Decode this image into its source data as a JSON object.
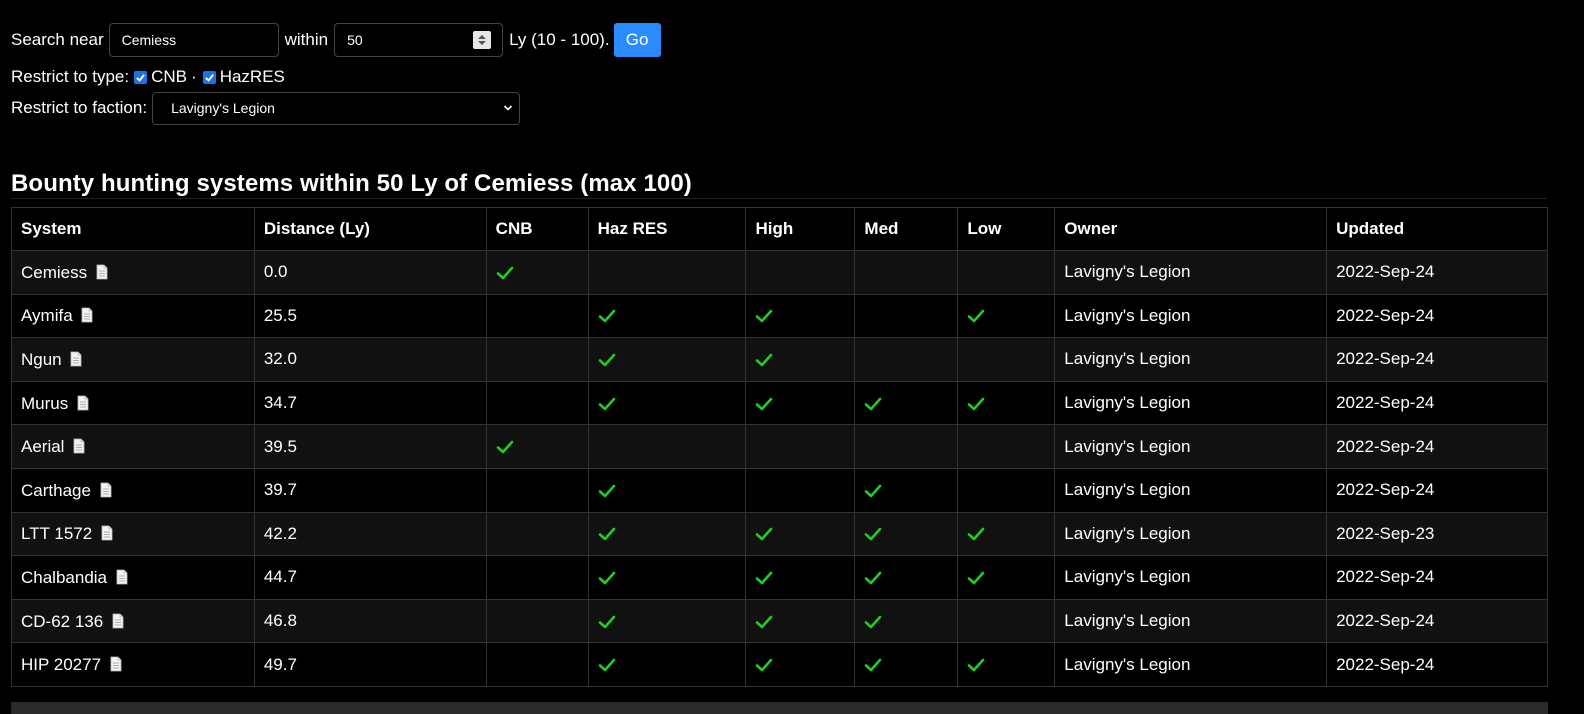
{
  "search": {
    "near_label": "Search near",
    "near_value": "Cemiess",
    "within_label": "within",
    "within_value": "50",
    "range_label": "Ly (10 - 100).",
    "go_label": "Go"
  },
  "type_filter": {
    "label": "Restrict to type:",
    "options": [
      {
        "label": "CNB",
        "checked": true
      },
      {
        "label": "HazRES",
        "checked": true
      }
    ],
    "separator": "·"
  },
  "faction_filter": {
    "label": "Restrict to faction:",
    "selected": "Lavigny's Legion"
  },
  "results": {
    "title_prefix": "Bounty hunting systems within ",
    "title_distance": "50 Ly",
    "title_mid": " of ",
    "title_system": "Cemiess",
    "title_suffix": " (max 100)",
    "columns": [
      "System",
      "Distance (Ly)",
      "CNB",
      "Haz RES",
      "High",
      "Med",
      "Low",
      "Owner",
      "Updated"
    ],
    "rows": [
      {
        "system": "Cemiess",
        "distance": "0.0",
        "cnb": true,
        "haz": false,
        "high": false,
        "med": false,
        "low": false,
        "owner": "Lavigny's Legion",
        "updated": "2022-Sep-24"
      },
      {
        "system": "Aymifa",
        "distance": "25.5",
        "cnb": false,
        "haz": true,
        "high": true,
        "med": false,
        "low": true,
        "owner": "Lavigny's Legion",
        "updated": "2022-Sep-24"
      },
      {
        "system": "Ngun",
        "distance": "32.0",
        "cnb": false,
        "haz": true,
        "high": true,
        "med": false,
        "low": false,
        "owner": "Lavigny's Legion",
        "updated": "2022-Sep-24"
      },
      {
        "system": "Murus",
        "distance": "34.7",
        "cnb": false,
        "haz": true,
        "high": true,
        "med": true,
        "low": true,
        "owner": "Lavigny's Legion",
        "updated": "2022-Sep-24"
      },
      {
        "system": "Aerial",
        "distance": "39.5",
        "cnb": true,
        "haz": false,
        "high": false,
        "med": false,
        "low": false,
        "owner": "Lavigny's Legion",
        "updated": "2022-Sep-24"
      },
      {
        "system": "Carthage",
        "distance": "39.7",
        "cnb": false,
        "haz": true,
        "high": false,
        "med": true,
        "low": false,
        "owner": "Lavigny's Legion",
        "updated": "2022-Sep-24"
      },
      {
        "system": "LTT 1572",
        "distance": "42.2",
        "cnb": false,
        "haz": true,
        "high": true,
        "med": true,
        "low": true,
        "owner": "Lavigny's Legion",
        "updated": "2022-Sep-23"
      },
      {
        "system": "Chalbandia",
        "distance": "44.7",
        "cnb": false,
        "haz": true,
        "high": true,
        "med": true,
        "low": true,
        "owner": "Lavigny's Legion",
        "updated": "2022-Sep-24"
      },
      {
        "system": "CD-62 136",
        "distance": "46.8",
        "cnb": false,
        "haz": true,
        "high": true,
        "med": true,
        "low": false,
        "owner": "Lavigny's Legion",
        "updated": "2022-Sep-24"
      },
      {
        "system": "HIP 20277",
        "distance": "49.7",
        "cnb": false,
        "haz": true,
        "high": true,
        "med": true,
        "low": true,
        "owner": "Lavigny's Legion",
        "updated": "2022-Sep-24"
      }
    ]
  },
  "icons": {
    "system_doc": "document-icon",
    "tick": "check-icon",
    "tick_color": "#22cc22"
  },
  "colors": {
    "background": "#000000",
    "accent": "#2b8cff",
    "link": "#4da3ff"
  }
}
